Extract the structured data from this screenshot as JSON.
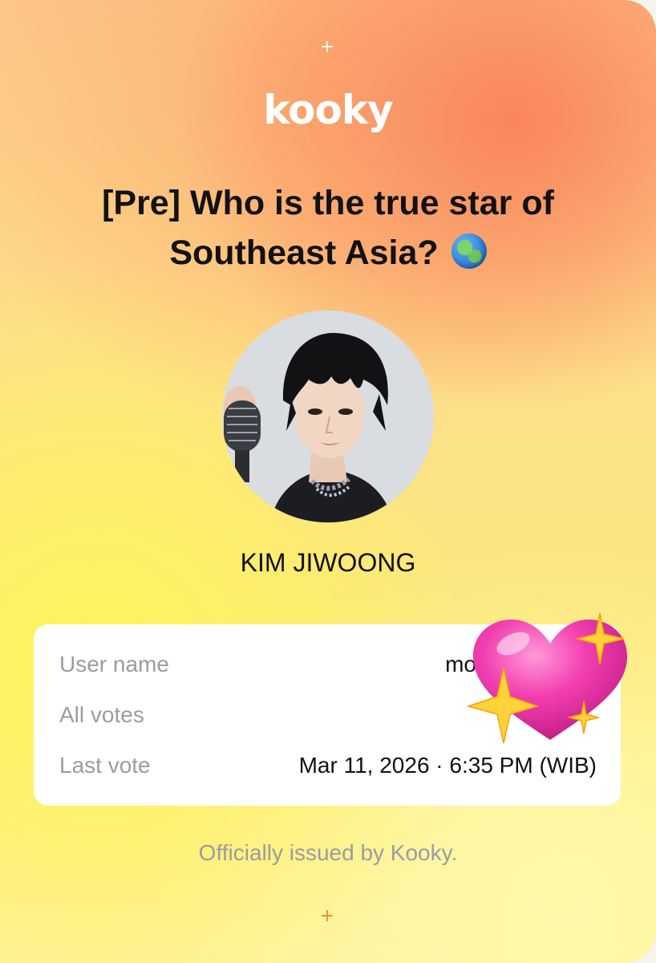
{
  "brand": {
    "logo": "kooky",
    "sparkle_top": "+",
    "sparkle_bottom": "+",
    "top_accent_color": "#ffffff",
    "bottom_accent_color": "#f28a2c"
  },
  "poll": {
    "title": "[Pre] Who is the true star of Southeast Asia?",
    "title_emoji": "earth-globe-asia-australia"
  },
  "candidate": {
    "name": "KIM JIWOONG",
    "photo": "candidate-photo"
  },
  "certificate": {
    "rows": [
      {
        "label": "User name",
        "value": "mo"
      },
      {
        "label": "All votes",
        "value": ""
      },
      {
        "label": "Last vote",
        "value": "Mar 11, 2026 · 6:35 PM (WIB)"
      }
    ]
  },
  "footer": {
    "text": "Officially issued by Kooky."
  },
  "sticker": {
    "icon": "sparkling-heart-emoji",
    "heart_color": "#f23fb0",
    "sparkle_color": "#ffd23a"
  }
}
